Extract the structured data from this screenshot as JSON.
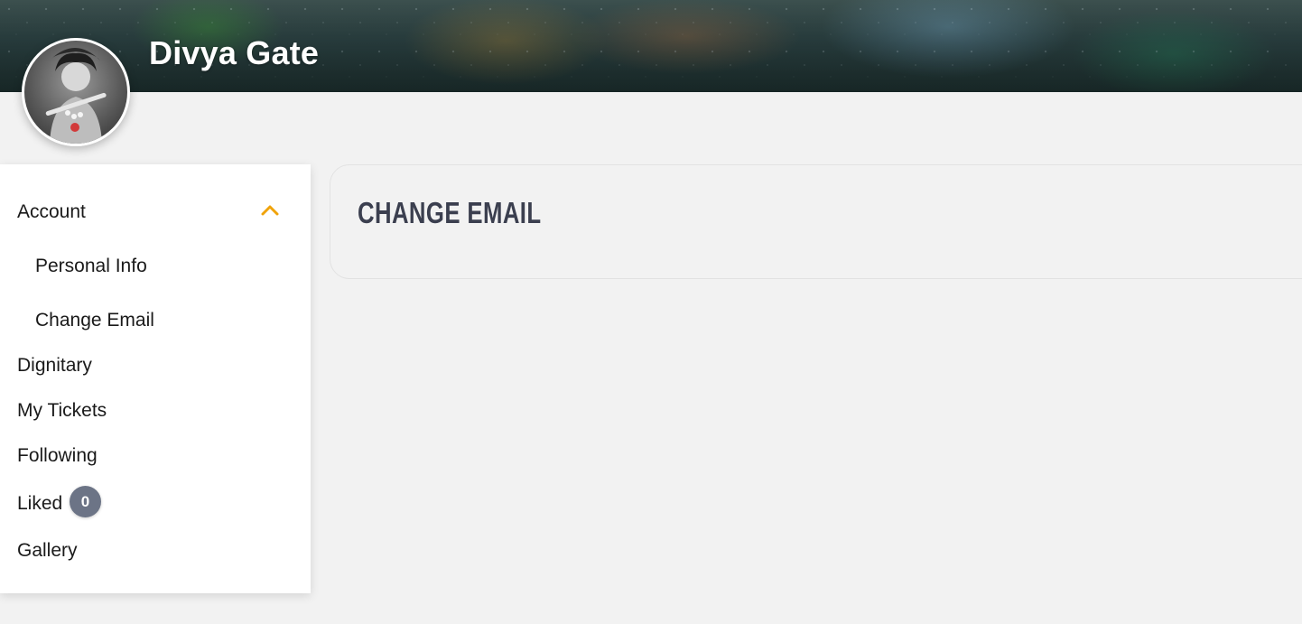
{
  "header": {
    "user_name": "Divya Gate",
    "avatar_icon": "profile-avatar"
  },
  "sidebar": {
    "items": [
      {
        "label": "Account",
        "expanded": true,
        "icon": "chevron-up-icon",
        "accent_color": "#f0a30a"
      },
      {
        "label": "Personal Info",
        "sub": true
      },
      {
        "label": "Change Email",
        "sub": true
      },
      {
        "label": "Dignitary"
      },
      {
        "label": "My Tickets"
      },
      {
        "label": "Following"
      },
      {
        "label": "Liked",
        "badge": "0"
      },
      {
        "label": "Gallery"
      }
    ]
  },
  "main": {
    "title": "CHANGE EMAIL"
  },
  "colors": {
    "accent": "#f0a30a",
    "badge": "#6c7486",
    "title": "#3b3f4f",
    "background": "#f2f2f2"
  }
}
